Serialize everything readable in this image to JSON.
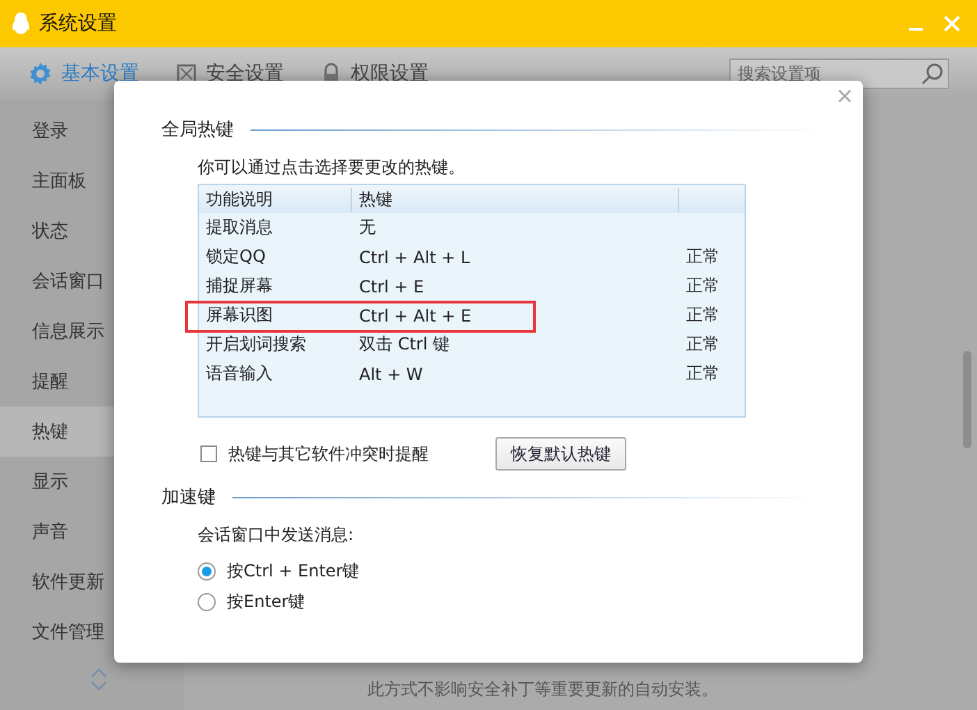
{
  "window": {
    "title": "系统设置"
  },
  "tabs": [
    {
      "label": "基本设置",
      "selected": true
    },
    {
      "label": "安全设置",
      "selected": false
    },
    {
      "label": "权限设置",
      "selected": false
    }
  ],
  "search": {
    "placeholder": "搜索设置项"
  },
  "sidebar": {
    "items": [
      {
        "label": "登录",
        "selected": false
      },
      {
        "label": "主面板",
        "selected": false
      },
      {
        "label": "状态",
        "selected": false
      },
      {
        "label": "会话窗口",
        "selected": false
      },
      {
        "label": "信息展示",
        "selected": false
      },
      {
        "label": "提醒",
        "selected": false
      },
      {
        "label": "热键",
        "selected": true
      },
      {
        "label": "显示",
        "selected": false
      },
      {
        "label": "声音",
        "selected": false
      },
      {
        "label": "软件更新",
        "selected": false
      },
      {
        "label": "文件管理",
        "selected": false
      }
    ]
  },
  "background": {
    "note": "此方式不影响安全补丁等重要更新的自动安装。"
  },
  "dialog": {
    "global_section": {
      "title": "全局热键",
      "hint": "你可以通过点击选择要更改的热键。",
      "table": {
        "columns": [
          "功能说明",
          "热键"
        ],
        "rows": [
          {
            "function": "提取消息",
            "hotkey": "无",
            "status": "",
            "highlighted": false
          },
          {
            "function": "锁定QQ",
            "hotkey": "Ctrl + Alt + L",
            "status": "正常",
            "highlighted": false
          },
          {
            "function": "捕捉屏幕",
            "hotkey": "Ctrl + E",
            "status": "正常",
            "highlighted": false
          },
          {
            "function": "屏幕识图",
            "hotkey": "Ctrl + Alt + E",
            "status": "正常",
            "highlighted": true
          },
          {
            "function": "开启划词搜索",
            "hotkey": "双击 Ctrl 键",
            "status": "正常",
            "highlighted": false
          },
          {
            "function": "语音输入",
            "hotkey": "Alt + W",
            "status": "正常",
            "highlighted": false
          }
        ]
      },
      "conflict_checkbox": {
        "label": "热键与其它软件冲突时提醒",
        "checked": false
      },
      "restore_button": "恢复默认热键"
    },
    "accel_section": {
      "title": "加速键",
      "label": "会话窗口中发送消息:",
      "options": [
        {
          "label": "按Ctrl + Enter键",
          "selected": true
        },
        {
          "label": "按Enter键",
          "selected": false
        }
      ]
    }
  }
}
